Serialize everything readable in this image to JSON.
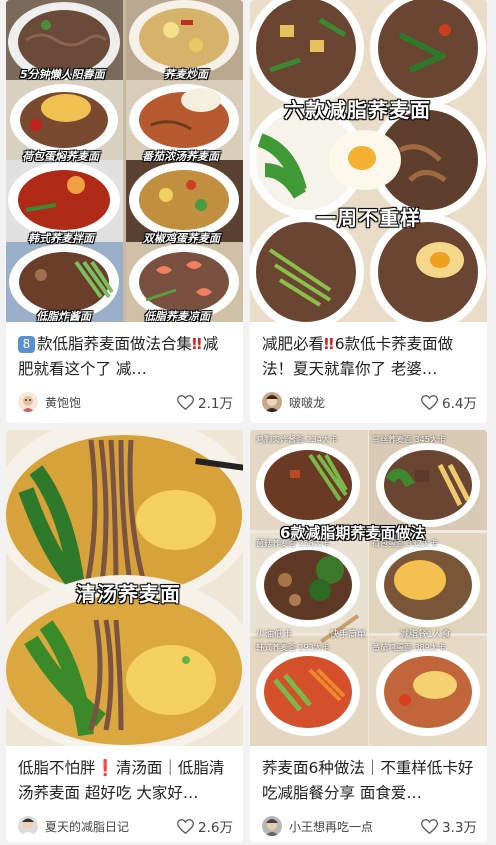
{
  "cards": [
    {
      "title_num": "8",
      "title_a": "款低脂荞麦面做法合集",
      "title_bang": "‼",
      "title_b": "减肥就看这个了 减…",
      "author": "黄饱饱",
      "likes": "2.1万",
      "captions": [
        "5分钟懒人阳春面",
        "荞麦炒面",
        "荷包蛋焖荞麦面",
        "番茄浓汤荞麦面",
        "韩式荞麦拌面",
        "双椒鸡蛋荞麦面",
        "低脂炸酱面",
        "低脂荞麦凉面"
      ]
    },
    {
      "title_a": "减肥必看",
      "title_bang": "‼",
      "title_b": "6款低卡荞麦面做法！夏天就靠你了 老婆…",
      "author": "啵啵龙",
      "likes": "6.4万",
      "captions": [
        "六款减脂荞麦面",
        "一周不重样"
      ]
    },
    {
      "title_a": "低脂不怕胖",
      "title_bang": "❗",
      "title_b": "清汤面｜低脂清汤荞麦面 超好吃 大家好…",
      "author": "夏天的减脂日记",
      "likes": "2.6万",
      "captions": [
        "清汤荞麦面"
      ]
    },
    {
      "title": "荞麦面6种做法｜不重样低卡好吃减脂餐分享 面食爱…",
      "author": "小王想再吃一点",
      "likes": "3.3万",
      "captions": [
        "6款减脂期荞麦面做法",
        "鸡胸肉炸酱面 234大卡",
        "三丝荞麦面 345大卡",
        "菌菇荞麦面 258大卡",
        "荷包蛋面 332大卡",
        "韩式荞麦面 293大卡",
        "番茄鸡蛋面 389大卡",
        "少油低卡",
        "快手简单",
        "减脂餐1人食"
      ]
    }
  ]
}
